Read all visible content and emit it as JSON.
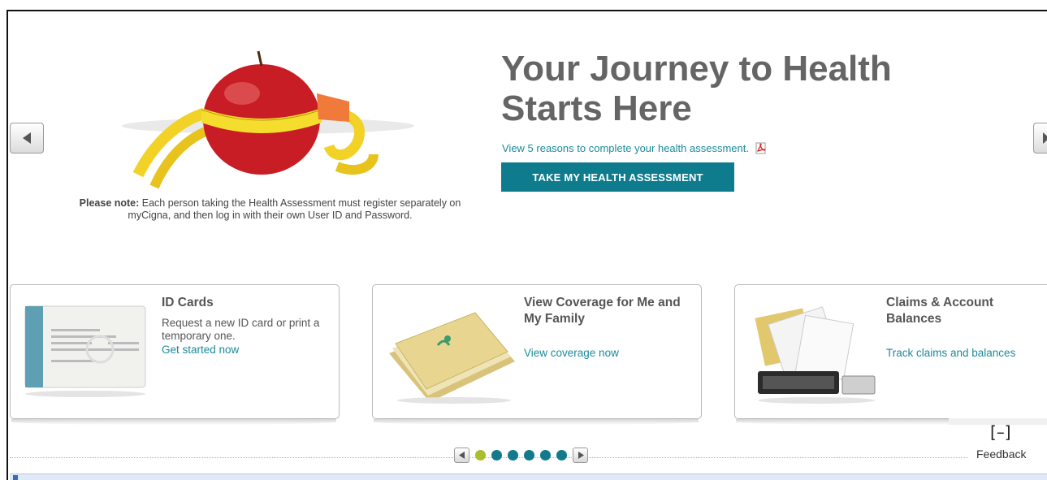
{
  "hero": {
    "title": "Your Journey to Health Starts Here",
    "link_text": "View 5 reasons to complete your health assessment.",
    "button_label": "TAKE MY HEALTH ASSESSMENT",
    "note_bold": "Please note:",
    "note_text": " Each person taking the Health Assessment must register separately on myCigna, and then log in with their own User ID and Password."
  },
  "cards": [
    {
      "title": "ID Cards",
      "description": "Request a new ID card or print a temporary one.",
      "link": "Get started now",
      "image": "id-card-image"
    },
    {
      "title": "View Coverage for Me and My Family",
      "description": "",
      "link": "View coverage now",
      "image": "cigna-folder-image"
    },
    {
      "title": "Claims & Account Balances",
      "description": "",
      "link": "Track claims and balances",
      "image": "claims-paperwork-image"
    }
  ],
  "pager": {
    "total_dots": 6,
    "active_index": 0
  },
  "feedback": {
    "toggle": "[–]",
    "label": "Feedback"
  },
  "colors": {
    "teal": "#0f7c8e",
    "link_teal": "#1a8a9c",
    "dot_active": "#a8be2c",
    "title_gray": "#656565"
  },
  "icons": [
    "chevron-left-icon",
    "chevron-right-icon",
    "pdf-icon"
  ]
}
